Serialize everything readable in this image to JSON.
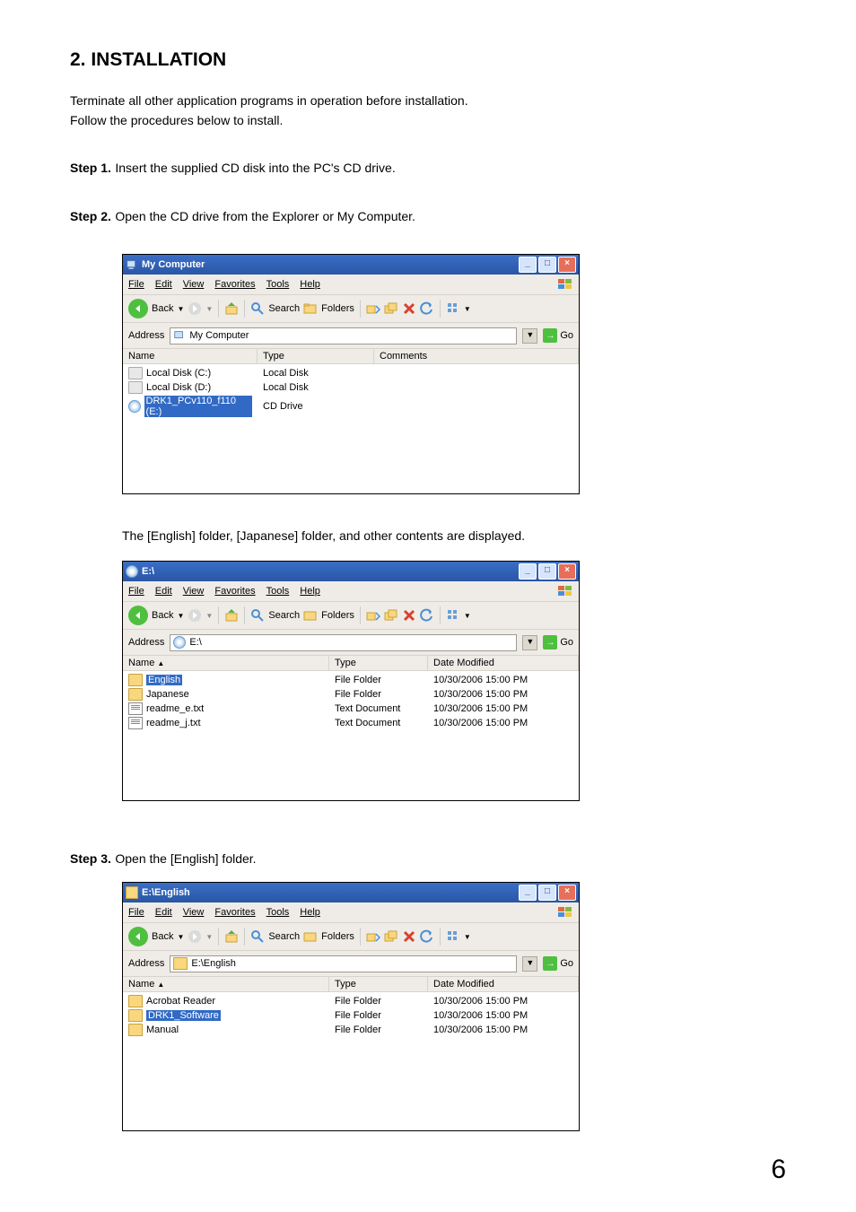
{
  "heading": "2. INSTALLATION",
  "intro1": "Terminate all other application programs in operation before installation.",
  "intro2": "Follow the procedures below to install.",
  "step1": {
    "label": "Step 1.",
    "text": "Insert the supplied CD disk into the PC's CD drive."
  },
  "step2": {
    "label": "Step 2.",
    "text": "Open the CD drive from the Explorer or My Computer."
  },
  "note2": "The [English] folder, [Japanese] folder, and other contents are displayed.",
  "step3": {
    "label": "Step 3.",
    "text": "Open the [English] folder."
  },
  "menu": {
    "file": "File",
    "edit": "Edit",
    "view": "View",
    "fav": "Favorites",
    "tools": "Tools",
    "help": "Help"
  },
  "tb": {
    "back": "Back",
    "search": "Search",
    "folders": "Folders"
  },
  "addr": {
    "label": "Address",
    "go": "Go"
  },
  "win1": {
    "title": "My Computer",
    "addrtext": "My Computer",
    "cols": {
      "name": "Name",
      "type": "Type",
      "comments": "Comments"
    },
    "rows": [
      {
        "name": "Local Disk (C:)",
        "type": "Local Disk",
        "kind": "drive",
        "sel": false
      },
      {
        "name": "Local Disk (D:)",
        "type": "Local Disk",
        "kind": "drive",
        "sel": false
      },
      {
        "name": "DRK1_PCv110_f110 (E:)",
        "type": "CD Drive",
        "kind": "cd",
        "sel": true
      }
    ]
  },
  "win2": {
    "title": "E:\\",
    "addrtext": "E:\\",
    "cols": {
      "name": "Name",
      "type": "Type",
      "date": "Date Modified"
    },
    "rows": [
      {
        "name": "English",
        "type": "File Folder",
        "date": "10/30/2006 15:00 PM",
        "kind": "folder",
        "sel": true
      },
      {
        "name": "Japanese",
        "type": "File Folder",
        "date": "10/30/2006 15:00 PM",
        "kind": "folder",
        "sel": false
      },
      {
        "name": "readme_e.txt",
        "type": "Text Document",
        "date": "10/30/2006 15:00 PM",
        "kind": "txt",
        "sel": false
      },
      {
        "name": "readme_j.txt",
        "type": "Text Document",
        "date": "10/30/2006 15:00 PM",
        "kind": "txt",
        "sel": false
      }
    ]
  },
  "win3": {
    "title": "E:\\English",
    "addrtext": "E:\\English",
    "cols": {
      "name": "Name",
      "type": "Type",
      "date": "Date Modified"
    },
    "rows": [
      {
        "name": "Acrobat Reader",
        "type": "File Folder",
        "date": "10/30/2006 15:00 PM",
        "kind": "folder",
        "sel": false
      },
      {
        "name": "DRK1_Software",
        "type": "File Folder",
        "date": "10/30/2006 15:00 PM",
        "kind": "folder",
        "sel": true
      },
      {
        "name": "Manual",
        "type": "File Folder",
        "date": "10/30/2006 15:00 PM",
        "kind": "folder",
        "sel": false
      }
    ]
  },
  "pagenum": "6"
}
